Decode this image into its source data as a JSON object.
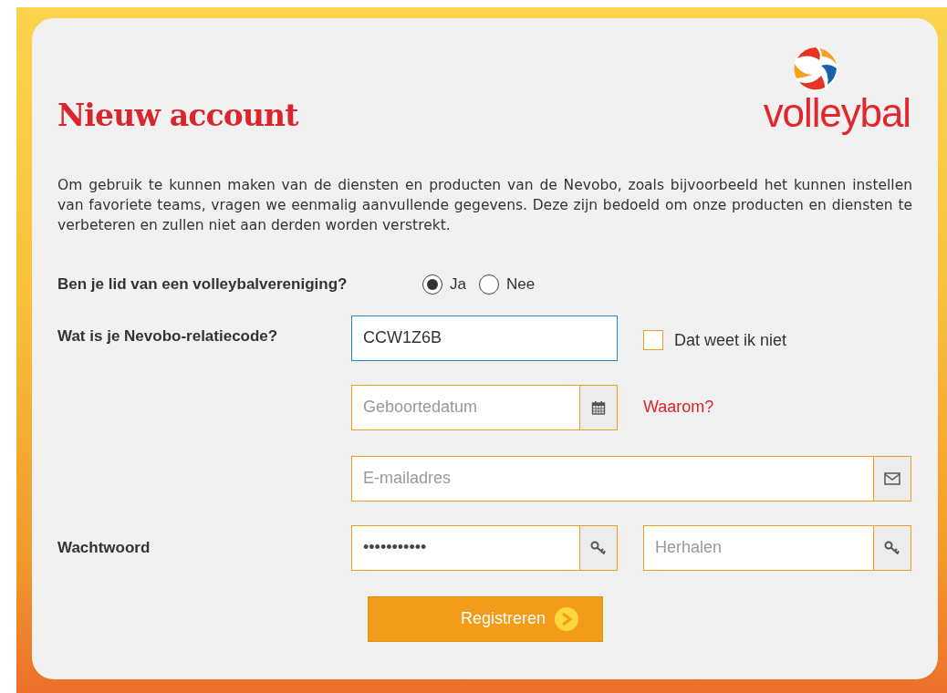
{
  "title": "Nieuw account",
  "logo": {
    "text": "volleybal"
  },
  "intro": "Om gebruik te kunnen maken van de diensten en producten van de Nevobo, zoals bijvoorbeeld het kunnen instellen van favoriete teams, vragen we eenmalig aanvullende gegevens. Deze zijn bedoeld om onze producten en diensten te verbeteren en zullen niet aan derden worden verstrekt.",
  "member_question": {
    "label": "Ben je lid van een volleybalvereniging?",
    "options": [
      {
        "label": "Ja",
        "selected": true
      },
      {
        "label": "Nee",
        "selected": false
      }
    ]
  },
  "relation_code": {
    "label": "Wat is je Nevobo-relatiecode?",
    "value": "CCW1Z6B",
    "focused": true,
    "unknown_checkbox": {
      "label": "Dat weet ik niet",
      "checked": false
    }
  },
  "birthdate": {
    "placeholder": "Geboortedatum",
    "link": "Waarom?"
  },
  "email": {
    "placeholder": "E-mailadres"
  },
  "password": {
    "label": "Wachtwoord",
    "value": "•••••••••••",
    "repeat_placeholder": "Herhalen"
  },
  "submit": "Registreren"
}
